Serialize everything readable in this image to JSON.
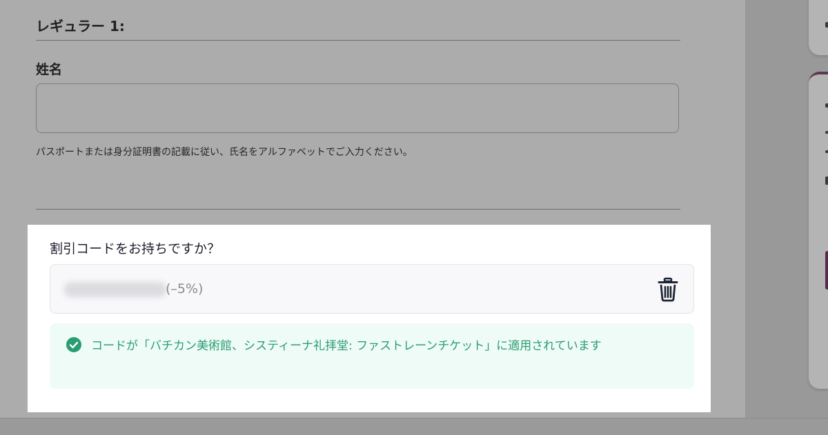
{
  "form": {
    "section_title": "レギュラー 1:",
    "name_label": "姓名",
    "name_value": "",
    "name_hint": "パスポートまたは身分証明書の記載に従い、氏名をアルファベットでご入力ください。"
  },
  "discount": {
    "title": "割引コードをお持ちですか？",
    "discount_text": "(–5%)",
    "success_message": "コードが「バチカン美術館、システィーナ礼拝堂: ファストレーンチケット」に適用されています",
    "success_color": "#2a9d72",
    "success_bg": "#effbf7"
  },
  "icons": {
    "trash": "trash-icon",
    "check": "check-circle-icon"
  }
}
